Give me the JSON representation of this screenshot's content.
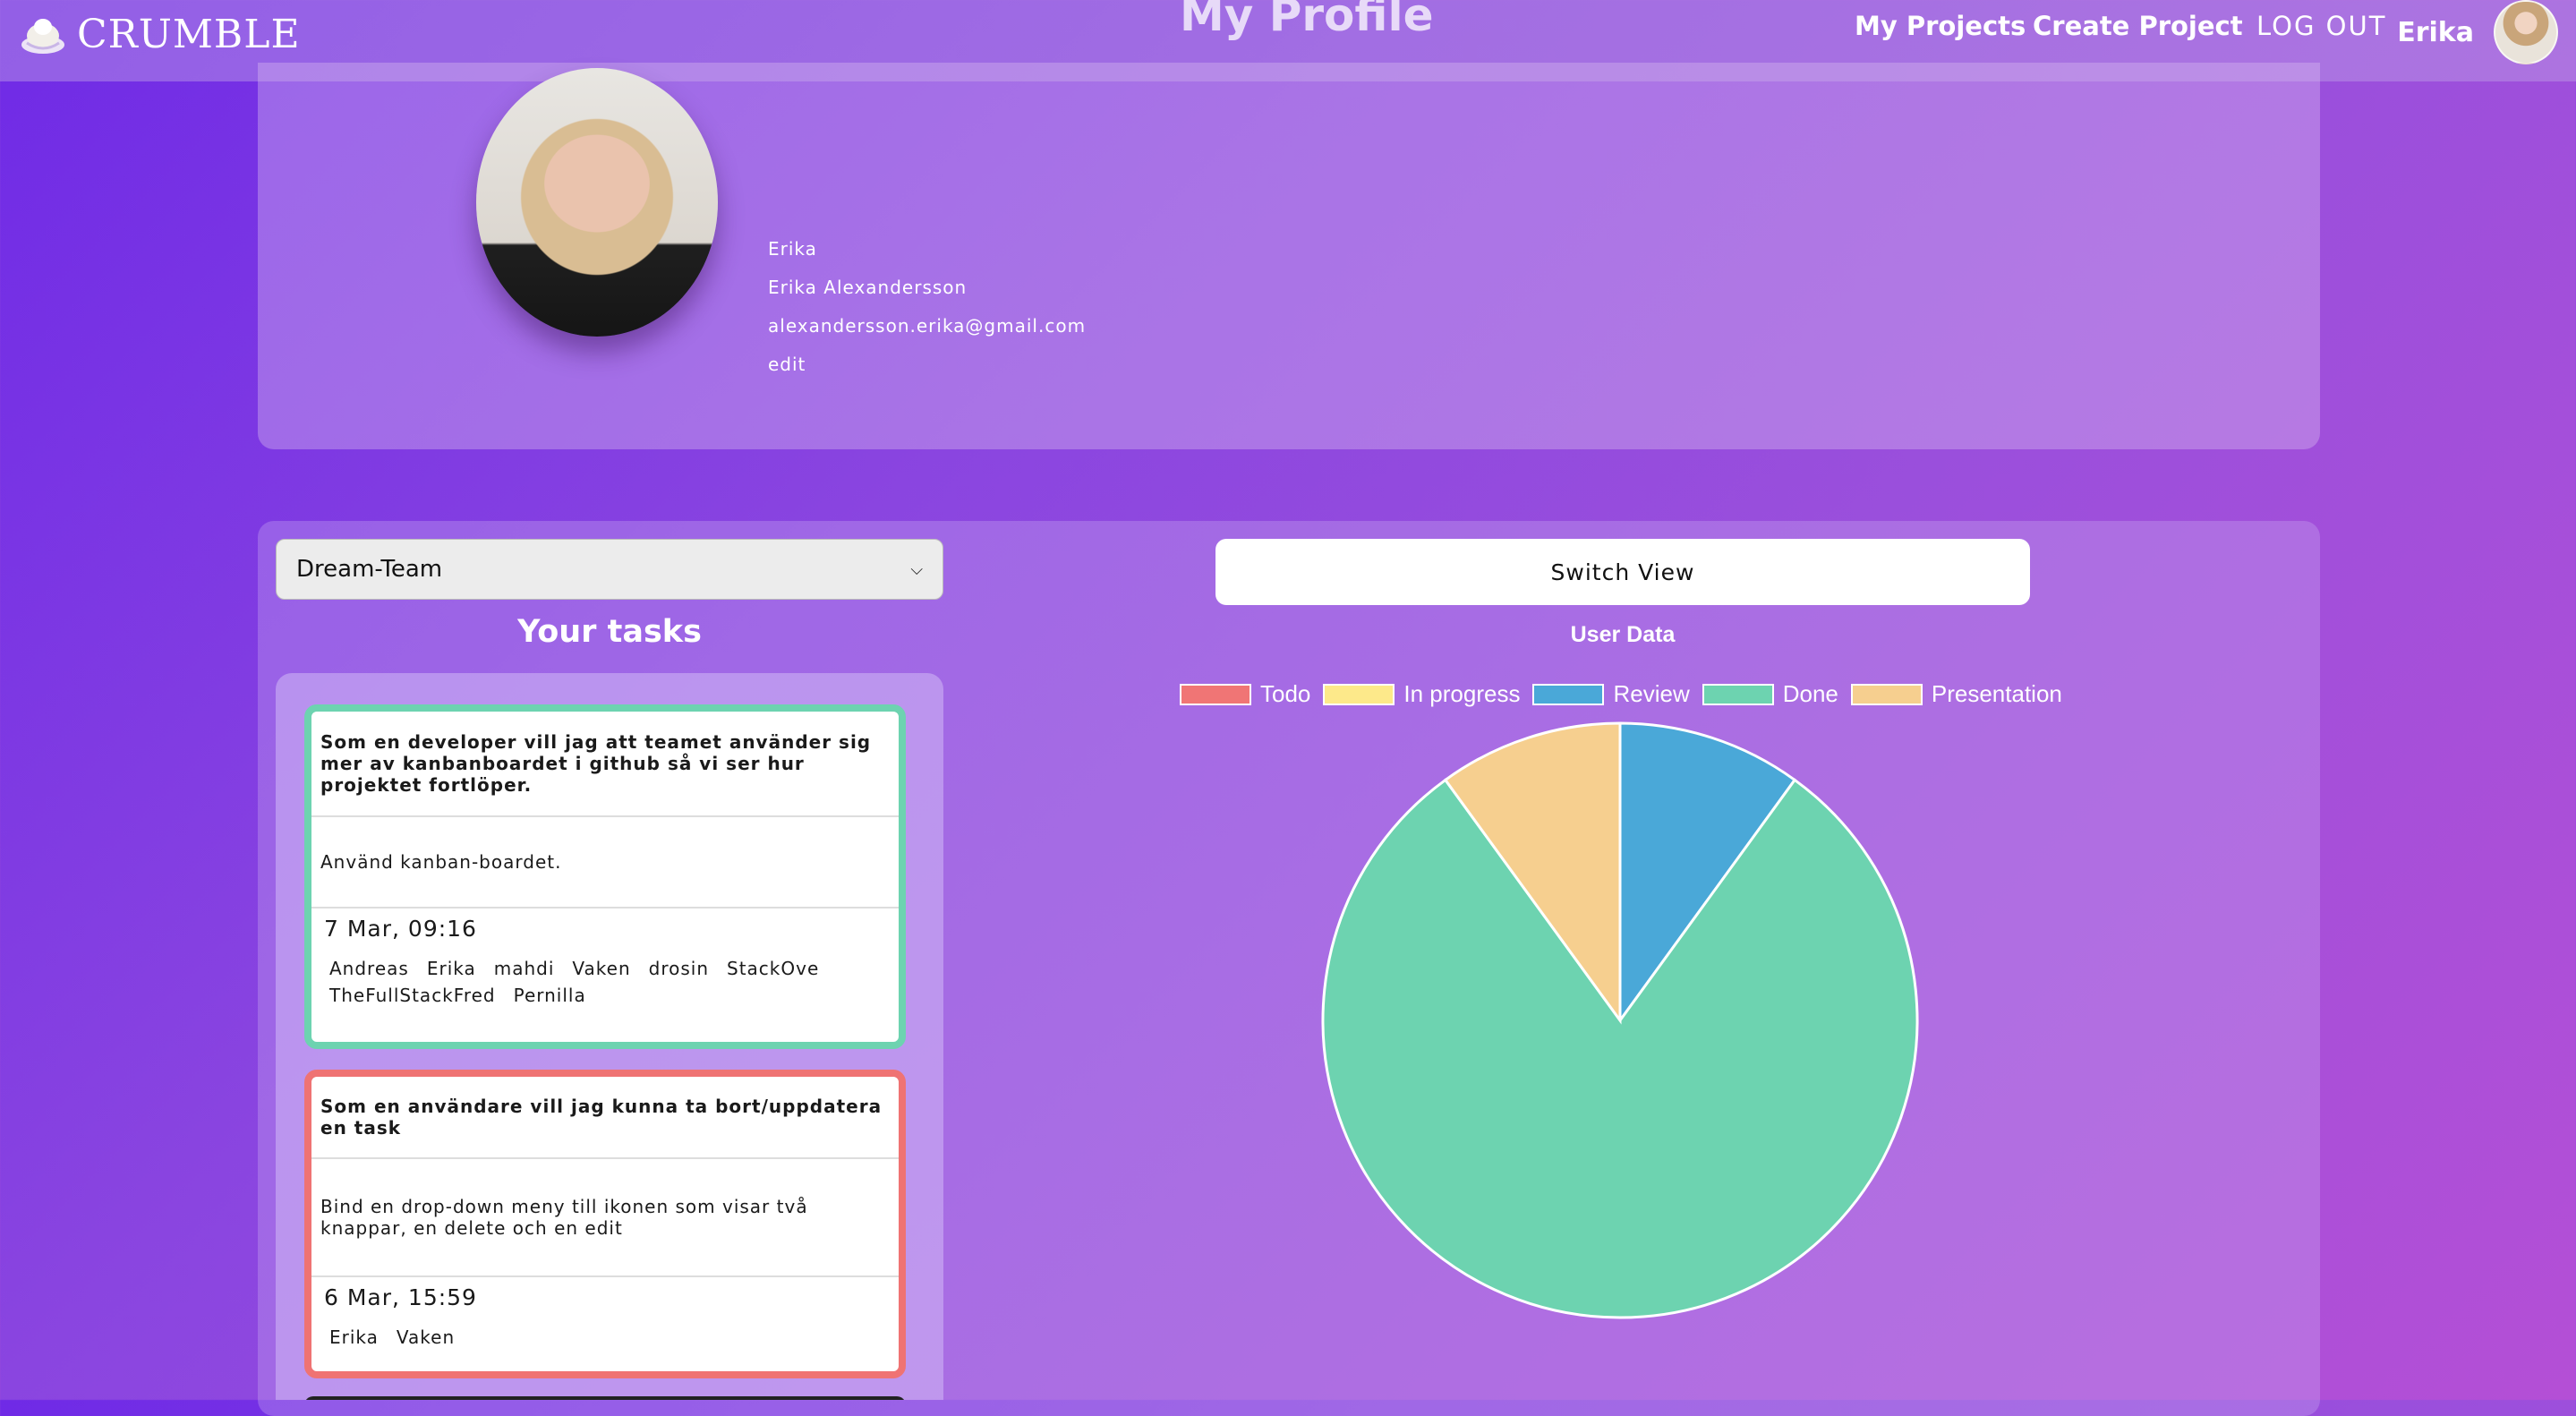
{
  "app": {
    "brand": "CRUMBLE",
    "page_title": "My Profile"
  },
  "nav": {
    "my_projects": "My Projects",
    "create_project": "Create Project",
    "logout": "LOG OUT",
    "username": "Erika"
  },
  "profile": {
    "username": "Erika",
    "full_name": "Erika Alexandersson",
    "email": "alexandersson.erika@gmail.com",
    "edit_label": "edit"
  },
  "team_select": {
    "selected": "Dream-Team"
  },
  "tasks": {
    "title": "Your tasks",
    "items": [
      {
        "title": "Som en developer vill jag att teamet använder sig mer av kanbanboardet i github så vi ser hur projektet fortlöper.",
        "description": "Använd kanban-boardet.",
        "date": "7 Mar, 09:16",
        "members": [
          "Andreas",
          "Erika",
          "mahdi",
          "Vaken",
          "drosin",
          "StackOve",
          "TheFullStackFred",
          "Pernilla"
        ],
        "status_color": "#6dd3b0"
      },
      {
        "title": "Som en användare vill jag kunna ta bort/uppdatera en task",
        "description": "Bind en drop-down meny till ikonen som visar två knappar, en delete och en edit",
        "date": "6 Mar, 15:59",
        "members": [
          "Erika",
          "Vaken"
        ],
        "status_color": "#ef7373"
      }
    ]
  },
  "chart": {
    "switch_view_label": "Switch View",
    "title": "User Data"
  },
  "chart_data": {
    "type": "pie",
    "title": "User Data",
    "categories": [
      "Todo",
      "In progress",
      "Review",
      "Done",
      "Presentation"
    ],
    "values": [
      0,
      0,
      1,
      8,
      1
    ],
    "colors": [
      "#f07575",
      "#fde98a",
      "#4aa8d8",
      "#6dd3b0",
      "#f6cf8f"
    ],
    "legend_position": "top"
  }
}
